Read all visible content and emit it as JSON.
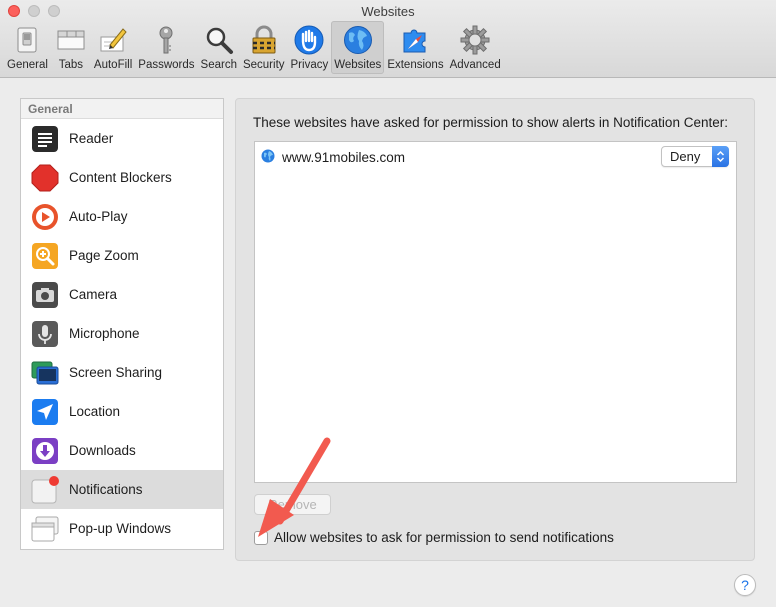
{
  "window": {
    "title": "Websites"
  },
  "toolbar": {
    "items": [
      {
        "label": "General",
        "icon": "switch-icon"
      },
      {
        "label": "Tabs",
        "icon": "tabs-icon"
      },
      {
        "label": "AutoFill",
        "icon": "pencil-form-icon"
      },
      {
        "label": "Passwords",
        "icon": "key-icon"
      },
      {
        "label": "Search",
        "icon": "magnifier-icon"
      },
      {
        "label": "Security",
        "icon": "padlock-icon"
      },
      {
        "label": "Privacy",
        "icon": "hand-icon"
      },
      {
        "label": "Websites",
        "icon": "globe-icon",
        "selected": true
      },
      {
        "label": "Extensions",
        "icon": "puzzle-icon"
      },
      {
        "label": "Advanced",
        "icon": "gear-icon"
      }
    ]
  },
  "sidebar": {
    "header": "General",
    "items": [
      {
        "label": "Reader",
        "icon": "reader-icon"
      },
      {
        "label": "Content Blockers",
        "icon": "stop-sign-icon"
      },
      {
        "label": "Auto-Play",
        "icon": "play-icon"
      },
      {
        "label": "Page Zoom",
        "icon": "zoom-icon"
      },
      {
        "label": "Camera",
        "icon": "camera-icon"
      },
      {
        "label": "Microphone",
        "icon": "microphone-icon"
      },
      {
        "label": "Screen Sharing",
        "icon": "screen-sharing-icon"
      },
      {
        "label": "Location",
        "icon": "location-arrow-icon"
      },
      {
        "label": "Downloads",
        "icon": "download-icon"
      },
      {
        "label": "Notifications",
        "icon": "notifications-icon",
        "selected": true
      },
      {
        "label": "Pop-up Windows",
        "icon": "popup-windows-icon"
      }
    ]
  },
  "main": {
    "description": "These websites have asked for permission to show alerts in Notification Center:",
    "sites": [
      {
        "url": "www.91mobiles.com",
        "permission": "Deny"
      }
    ],
    "remove_label": "Remove",
    "allow_label": "Allow websites to ask for permission to send notifications",
    "allow_checked": false
  },
  "help_label": "?",
  "colors": {
    "accent": "#2a72e4",
    "annotation_arrow": "#f25a4f"
  }
}
